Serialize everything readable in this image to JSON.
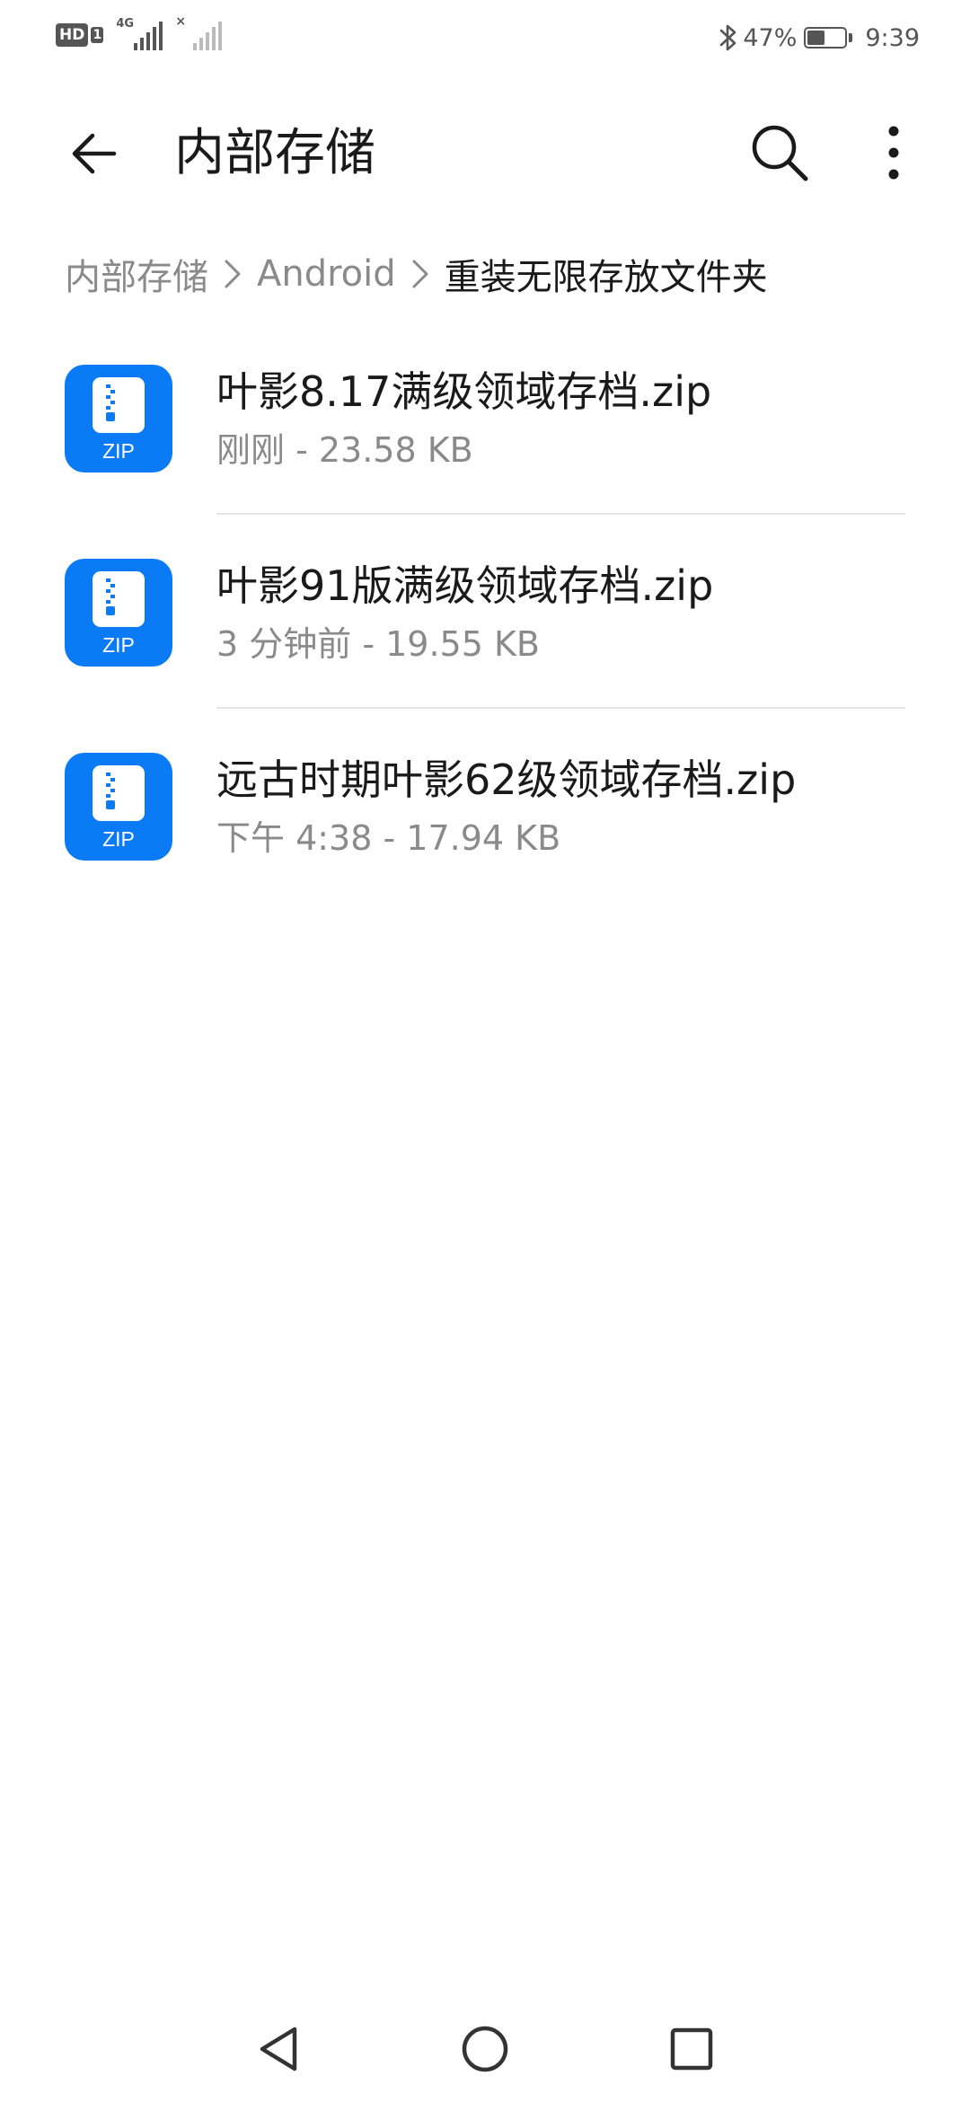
{
  "status_bar": {
    "hd_label": "HD",
    "sim_label": "1",
    "network_label": "4G",
    "bluetooth_icon": "bluetooth-icon",
    "battery_percent_text": "47%",
    "battery_level": 0.47,
    "time": "9:39"
  },
  "app_bar": {
    "title": "内部存储",
    "back_icon": "arrow-left-icon",
    "search_icon": "search-icon",
    "more_icon": "more-vertical-icon"
  },
  "breadcrumb": {
    "items": [
      {
        "label": "内部存储"
      },
      {
        "label": "Android"
      },
      {
        "label": "重装无限存放文件夹"
      }
    ],
    "separator_icon": "chevron-right-icon"
  },
  "files": [
    {
      "name": "叶影8.17满级领域存档.zip",
      "meta": "刚刚 - 23.58 KB",
      "icon_label": "ZIP",
      "icon": "zip-file-icon"
    },
    {
      "name": "叶影91版满级领域存档.zip",
      "meta": "3 分钟前 - 19.55 KB",
      "icon_label": "ZIP",
      "icon": "zip-file-icon"
    },
    {
      "name": "远古时期叶影62级领域存档.zip",
      "meta": "下午 4:38  - 17.94 KB",
      "icon_label": "ZIP",
      "icon": "zip-file-icon"
    }
  ],
  "nav_bar": {
    "back_icon": "nav-back-triangle-icon",
    "home_icon": "nav-home-circle-icon",
    "recents_icon": "nav-recents-square-icon"
  },
  "colors": {
    "accent": "#0a7bf4",
    "primary_text": "#1a1a1a",
    "secondary_text": "#8a8a8a",
    "divider": "#e4e4e4"
  }
}
